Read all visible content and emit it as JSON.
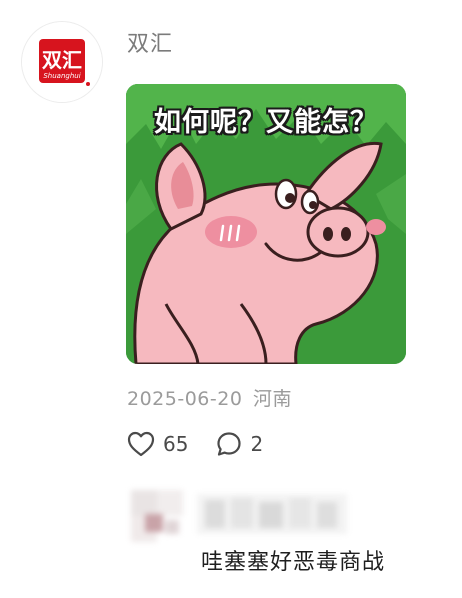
{
  "post": {
    "author": {
      "name": "双汇",
      "avatar_logo_text": "双汇",
      "avatar_logo_subtext": "Shuanghui",
      "brand_color": "#d7141e"
    },
    "image": {
      "caption": "如何呢？又能怎？",
      "background_color": "#3b9a3a",
      "subject": "pig-cartoon"
    },
    "date": "2025-06-20",
    "location": "河南",
    "likes": "65",
    "comments": "2"
  },
  "comment": {
    "text": "哇塞塞好恶毒商战",
    "author_blurred": true
  },
  "colors": {
    "secondary_text": "#9b9b9b",
    "username_text": "#7b7b7b",
    "primary_text": "#1f1f1f"
  }
}
